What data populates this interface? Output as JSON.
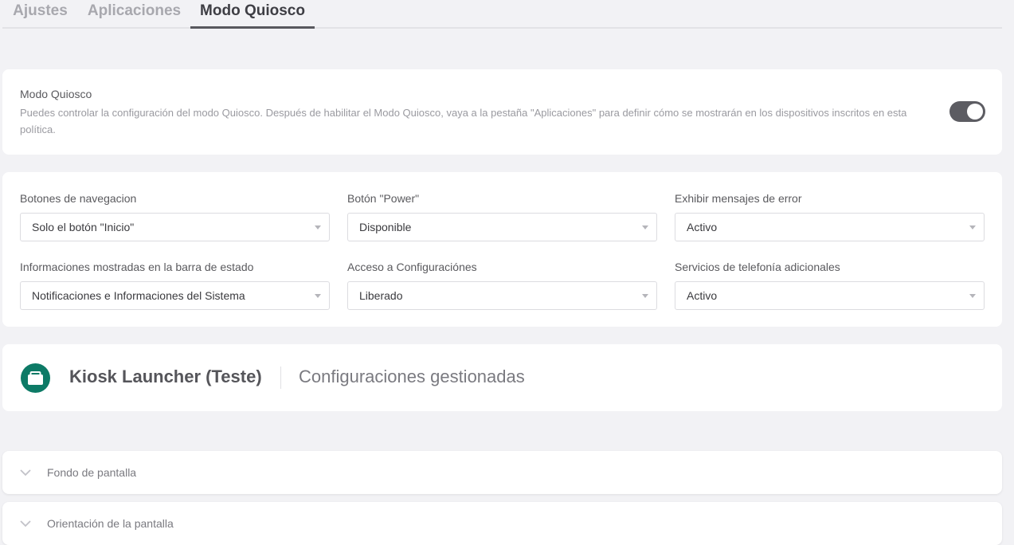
{
  "tabs": [
    {
      "label": "Ajustes",
      "active": false
    },
    {
      "label": "Aplicaciones",
      "active": false
    },
    {
      "label": "Modo Quiosco",
      "active": true
    }
  ],
  "kiosk": {
    "title": "Modo Quiosco",
    "description": "Puedes controlar la configuración del modo Quiosco. Después de habilitar el Modo Quiosco, vaya a la pestaña \"Aplicaciones\" para definir cómo se mostrarán en los dispositivos inscritos en esta política.",
    "enabled": true
  },
  "settings": [
    {
      "label": "Botones de navegacion",
      "value": "Solo el botón \"Inicio\""
    },
    {
      "label": "Botón \"Power\"",
      "value": "Disponible"
    },
    {
      "label": "Exhibir mensajes de error",
      "value": "Activo"
    },
    {
      "label": "Informaciones mostradas en la barra de estado",
      "value": "Notificaciones e Informaciones del Sistema"
    },
    {
      "label": "Acceso a Configuraciónes",
      "value": "Liberado"
    },
    {
      "label": "Servicios de telefonía adicionales",
      "value": "Activo"
    }
  ],
  "app": {
    "icon": "briefcase-icon",
    "icon_color": "#0d7a66",
    "name": "Kiosk Launcher (Teste)",
    "subtitle": "Configuraciones gestionadas"
  },
  "sections": [
    {
      "label": "Fondo de pantalla",
      "icon": "chevron-down-icon"
    },
    {
      "label": "Orientación de la pantalla",
      "icon": "chevron-down-icon"
    }
  ]
}
